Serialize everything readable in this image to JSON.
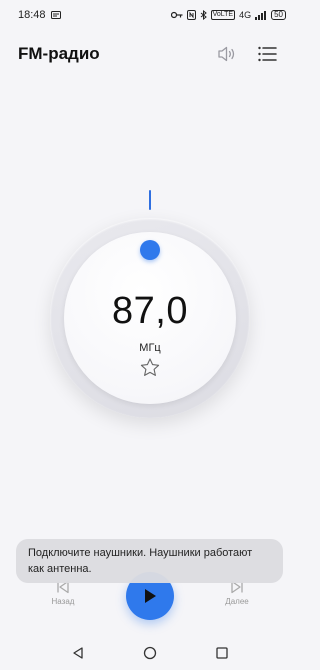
{
  "status_bar": {
    "time": "18:48",
    "network": "4G",
    "volte": "VoLTE",
    "battery": "50"
  },
  "header": {
    "title": "FM-радио"
  },
  "tuner": {
    "frequency": "87,0",
    "unit": "МГц"
  },
  "controls": {
    "prev_label": "Назад",
    "next_label": "Далее"
  },
  "toast": {
    "message": "Подключите наушники. Наушники работают как антенна."
  },
  "colors": {
    "accent": "#2f79ec",
    "background": "#f5f5f8"
  },
  "icons": {
    "speaker": "speaker-icon",
    "menu": "list-menu-icon",
    "favorite": "star-icon",
    "prev": "skip-back-icon",
    "next": "skip-forward-icon",
    "play": "play-icon",
    "nav_back": "triangle-back-icon",
    "nav_home": "circle-home-icon",
    "nav_recent": "square-recent-icon"
  }
}
